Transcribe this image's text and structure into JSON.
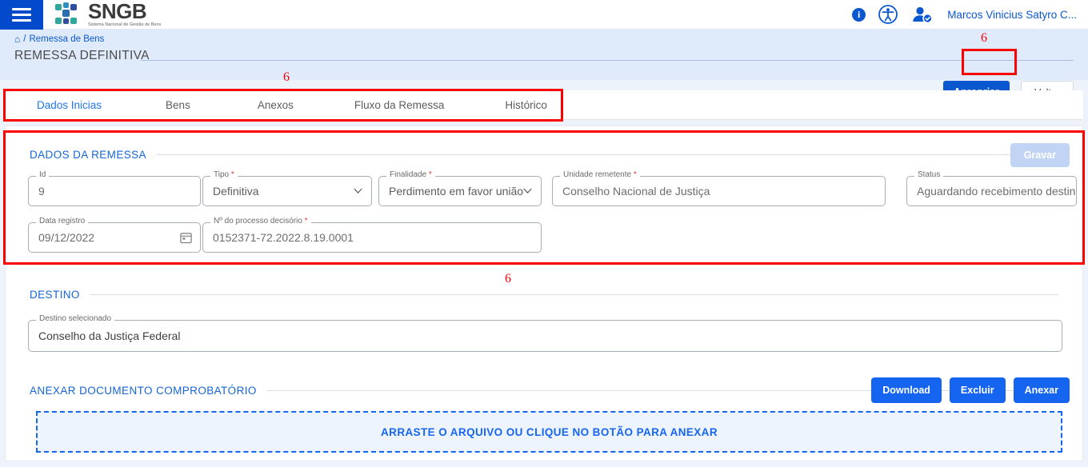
{
  "topbar": {
    "menu_icon": "hamburger-icon",
    "brand_title": "SNGB",
    "brand_subtitle": "Sistema Nacional de Gestão de Bens",
    "info_icon": "info-icon",
    "info_glyph": "i",
    "accessibility_icon": "accessibility-icon",
    "user_icon": "user-account-icon",
    "user_name": "Marcos Vinicius Satyro C..."
  },
  "breadcrumb": {
    "home_icon": "home-icon",
    "home_glyph": "⌂",
    "separator": "/",
    "item": "Remessa de Bens"
  },
  "header": {
    "page_title": "REMESSA DEFINITIVA",
    "apropriar_label": "Apropriar",
    "voltar_label": "Voltar"
  },
  "tabs": [
    {
      "label": "Dados Inicias",
      "active": true
    },
    {
      "label": "Bens",
      "active": false
    },
    {
      "label": "Anexos",
      "active": false
    },
    {
      "label": "Fluxo da Remessa",
      "active": false
    },
    {
      "label": "Histórico",
      "active": false
    }
  ],
  "dados_remessa": {
    "section_title": "DADOS DA REMESSA",
    "gravar_label": "Gravar",
    "fields": {
      "id": {
        "label": "Id",
        "value": "9",
        "required": false
      },
      "tipo": {
        "label": "Tipo",
        "value": "Definitiva",
        "required": true
      },
      "finalidade": {
        "label": "Finalidade",
        "value": "Perdimento em favor união",
        "required": true
      },
      "unidade_remetente": {
        "label": "Unidade remetente",
        "value": "Conselho Nacional de Justiça",
        "required": true
      },
      "status": {
        "label": "Status",
        "value": "Aguardando recebimento destinatário",
        "required": false
      },
      "data_registro": {
        "label": "Data registro",
        "value": "09/12/2022",
        "required": false
      },
      "processo": {
        "label": "Nº do processo decisório",
        "value": "0152371-72.2022.8.19.0001",
        "required": true
      }
    }
  },
  "destino": {
    "section_title": "DESTINO",
    "field": {
      "label": "Destino selecionado",
      "value": "Conselho da Justiça Federal"
    }
  },
  "anexar": {
    "section_title": "ANEXAR DOCUMENTO COMPROBATÓRIO",
    "buttons": [
      {
        "label": "Download"
      },
      {
        "label": "Excluir"
      },
      {
        "label": "Anexar"
      }
    ],
    "dropzone_text": "ARRASTE O ARQUIVO OU CLIQUE NO BOTÃO PARA ANEXAR"
  },
  "annotations": {
    "color": "#fa0000",
    "markers": [
      {
        "id": "apropriar",
        "number": "6"
      },
      {
        "id": "tabs",
        "number": "6"
      },
      {
        "id": "dados-remessa",
        "number": "6"
      },
      {
        "id": "destino",
        "number": "6"
      }
    ]
  },
  "colors": {
    "brand_blue": "#0349cc",
    "accent_blue": "#1565f0",
    "link_blue": "#0b57d0",
    "band_blue": "#dfeafb",
    "annotation_red": "#fa0000"
  }
}
